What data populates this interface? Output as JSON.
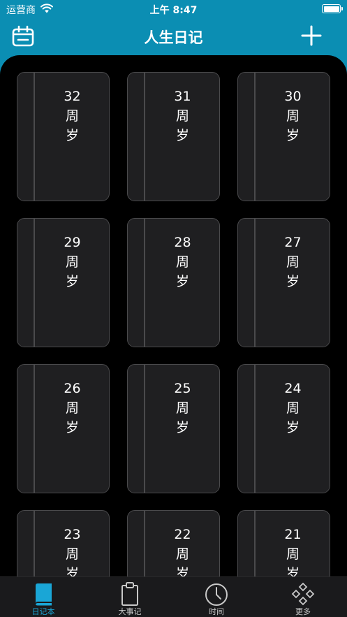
{
  "status": {
    "carrier": "运营商",
    "time": "上午 8:47"
  },
  "nav": {
    "title": "人生日记",
    "left_icon": "calendar-icon",
    "right_icon": "plus-icon"
  },
  "books": [
    {
      "num": "32",
      "line1": "周",
      "line2": "岁"
    },
    {
      "num": "31",
      "line1": "周",
      "line2": "岁"
    },
    {
      "num": "30",
      "line1": "周",
      "line2": "岁"
    },
    {
      "num": "29",
      "line1": "周",
      "line2": "岁"
    },
    {
      "num": "28",
      "line1": "周",
      "line2": "岁"
    },
    {
      "num": "27",
      "line1": "周",
      "line2": "岁"
    },
    {
      "num": "26",
      "line1": "周",
      "line2": "岁"
    },
    {
      "num": "25",
      "line1": "周",
      "line2": "岁"
    },
    {
      "num": "24",
      "line1": "周",
      "line2": "岁"
    },
    {
      "num": "23",
      "line1": "周",
      "line2": "岁"
    },
    {
      "num": "22",
      "line1": "周",
      "line2": "岁"
    },
    {
      "num": "21",
      "line1": "周",
      "line2": "岁"
    }
  ],
  "tabs": [
    {
      "label": "日记本",
      "icon": "book-icon",
      "active": true
    },
    {
      "label": "大事记",
      "icon": "clipboard-icon",
      "active": false
    },
    {
      "label": "时间",
      "icon": "clock-icon",
      "active": false
    },
    {
      "label": "更多",
      "icon": "diamonds-icon",
      "active": false
    }
  ],
  "colors": {
    "header": "#0b8eb3",
    "accent": "#1aa6d6",
    "card": "#1f1f21"
  }
}
